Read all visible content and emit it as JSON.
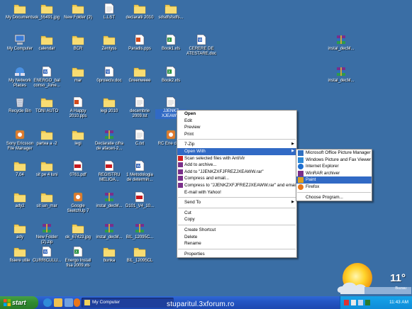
{
  "desktop": {
    "icons": [
      {
        "label": "My Documents",
        "kind": "folder-doc"
      },
      {
        "label": "ok_55491.jpg",
        "kind": "folder"
      },
      {
        "label": "New Folder (2)",
        "kind": "folder"
      },
      {
        "label": "L.LST",
        "kind": "file"
      },
      {
        "label": "declaratii 2010",
        "kind": "folder"
      },
      {
        "label": "sdsdfsfsdfs...",
        "kind": "folder"
      },
      {
        "label": "My Computer",
        "kind": "computer"
      },
      {
        "label": "calendar",
        "kind": "folder"
      },
      {
        "label": "BCR",
        "kind": "folder"
      },
      {
        "label": "Zentyss",
        "kind": "folder"
      },
      {
        "label": "Paradis.pps",
        "kind": "pps"
      },
      {
        "label": "Book1.xls",
        "kind": "xls"
      },
      {
        "label": "CERERE DE ATESTARE.doc",
        "kind": "doc"
      },
      {
        "label": "instal_decM...",
        "kind": "rar"
      },
      {
        "label": "My Network Places",
        "kind": "network"
      },
      {
        "label": "ENERGO_bal conso_June...",
        "kind": "doc"
      },
      {
        "label": "mar",
        "kind": "folder"
      },
      {
        "label": "0proiectv.doc",
        "kind": "doc"
      },
      {
        "label": "Greenweee",
        "kind": "folder"
      },
      {
        "label": "Book2.xls",
        "kind": "xls"
      },
      {
        "label": "instal_decM...",
        "kind": "rar"
      },
      {
        "label": "Recycle Bin",
        "kind": "recycle"
      },
      {
        "label": "TONI AUTO",
        "kind": "folder"
      },
      {
        "label": "A Happy 2010.pps",
        "kind": "pps"
      },
      {
        "label": "legi 2010",
        "kind": "folder"
      },
      {
        "label": "decembrie 2009.lst",
        "kind": "file"
      },
      {
        "label": "JJENKZ XJEAWW",
        "kind": "file",
        "selected": true
      },
      {
        "label": "Sony Ericsson File Manager",
        "kind": "app"
      },
      {
        "label": "partea a -2",
        "kind": "folder"
      },
      {
        "label": "legi",
        "kind": "folder"
      },
      {
        "label": "Declaratie cifra de afaceri-2...",
        "kind": "rar"
      },
      {
        "label": "C.txt",
        "kind": "file"
      },
      {
        "label": "RC Ene client",
        "kind": "app"
      },
      {
        "label": "7.04",
        "kind": "folder"
      },
      {
        "label": "sit pe 4 luni",
        "kind": "folder"
      },
      {
        "label": "0761.pdf",
        "kind": "pdf"
      },
      {
        "label": "REGISTRU MELIOA...",
        "kind": "pdf"
      },
      {
        "label": "1 Metodologia de determin...",
        "kind": "doc"
      },
      {
        "label": "ady2",
        "kind": "folder"
      },
      {
        "label": "sit ian_mar",
        "kind": "folder"
      },
      {
        "label": "Google SketchUp 7",
        "kind": "app"
      },
      {
        "label": "instal_decM...",
        "kind": "rar"
      },
      {
        "label": "D101_V4_10...",
        "kind": "pdf"
      },
      {
        "label": "ady",
        "kind": "folder"
      },
      {
        "label": "New Folder (2).zip",
        "kind": "rar"
      },
      {
        "label": "ok_67423.jpg",
        "kind": "folder"
      },
      {
        "label": "instal_decM...",
        "kind": "rar"
      },
      {
        "label": "BIL_12095C...",
        "kind": "rar"
      },
      {
        "label": "fisiere utile",
        "kind": "folder"
      },
      {
        "label": "CURRICULU...",
        "kind": "doc"
      },
      {
        "label": "Energo Install fisa 2009.xls",
        "kind": "xls"
      },
      {
        "label": "bunka",
        "kind": "folder"
      },
      {
        "label": "BIL_12095CL",
        "kind": "folder"
      }
    ]
  },
  "context_menu": {
    "items": [
      {
        "label": "Open",
        "bold": true
      },
      {
        "label": "Edit"
      },
      {
        "label": "Preview"
      },
      {
        "label": "Print"
      },
      {
        "sep": true
      },
      {
        "label": "7-Zip",
        "submenu": true
      },
      {
        "label": "Open With",
        "submenu": true,
        "highlighted": true
      },
      {
        "label": "Scan selected files with AntiVir",
        "icon": "antivir-icon"
      },
      {
        "label": "Add to archive...",
        "icon": "winrar-icon"
      },
      {
        "label": "Add to \"JJENKZXFJFREZJXEAWW.rar\"",
        "icon": "winrar-icon"
      },
      {
        "label": "Compress and email...",
        "icon": "winrar-icon"
      },
      {
        "label": "Compress to \"JJENKZXFJFREZJXEAWW.rar\" and email",
        "icon": "winrar-icon"
      },
      {
        "label": "E-mail with Yahoo!"
      },
      {
        "sep": true
      },
      {
        "label": "Send To",
        "submenu": true
      },
      {
        "sep": true
      },
      {
        "label": "Cut"
      },
      {
        "label": "Copy"
      },
      {
        "sep": true
      },
      {
        "label": "Create Shortcut"
      },
      {
        "label": "Delete"
      },
      {
        "label": "Rename"
      },
      {
        "sep": true
      },
      {
        "label": "Properties"
      }
    ]
  },
  "open_with_menu": {
    "items": [
      {
        "label": "Microsoft Office Picture Manager",
        "icon": "picture-manager-icon"
      },
      {
        "label": "Windows Picture and Fax Viewer",
        "icon": "picture-viewer-icon"
      },
      {
        "label": "Internet Explorer",
        "icon": "internet-explorer-icon"
      },
      {
        "label": "WinRAR archiver",
        "icon": "winrar-icon"
      },
      {
        "label": "Paint",
        "icon": "paint-icon",
        "highlighted": true
      },
      {
        "label": "Firefox",
        "icon": "firefox-icon"
      },
      {
        "sep": true
      },
      {
        "label": "Choose Program..."
      }
    ]
  },
  "taskbar": {
    "start_label": "start",
    "task_label": "My Computer",
    "clock": "11:43 AM"
  },
  "weather": {
    "temp": "11°",
    "location": "Buzau"
  },
  "watermark": "stuparitul.3xforum.ro",
  "colors": {
    "desktop": "#3a6ea5",
    "highlight": "#316ac5",
    "taskbar": "#245ac8",
    "start": "#3a9a3a"
  }
}
